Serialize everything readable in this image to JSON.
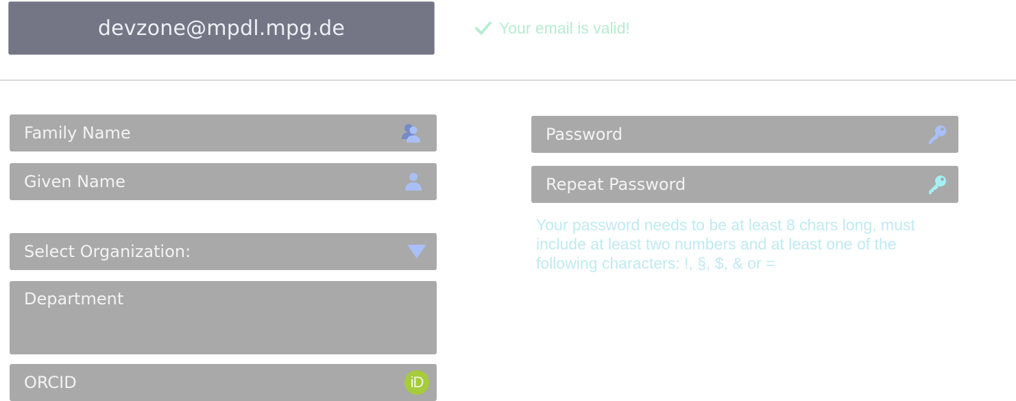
{
  "account": {
    "email": "devzone@mpdl.mpg.de",
    "email_status": "Your email is valid!"
  },
  "form": {
    "family_name_placeholder": "Family Name",
    "given_name_placeholder": "Given Name",
    "organization_placeholder": "Select Organization:",
    "department_placeholder": "Department",
    "orcid_placeholder": "ORCID",
    "orcid_icon_text": "iD",
    "password_placeholder": "Password",
    "repeat_password_placeholder": "Repeat Password",
    "password_hint": "Your password needs to be at least 8 chars long, must include at least two numbers and at least one of the following characters: !, §, $, & or ="
  },
  "icons": {
    "email_status": "check-icon",
    "family_name": "users-icon",
    "given_name": "user-icon",
    "organization": "triangle-down-icon",
    "orcid": "orcid-icon",
    "password": "key-icon",
    "repeat_password": "key-icon"
  },
  "colors": {
    "email_box": "#747686",
    "field_background": "#a9a9a9",
    "valid_text": "#b7ecd2",
    "icon_blue": "#a9bff7",
    "icon_cyan": "#a6f0f2",
    "orcid_green": "#a6cb3c",
    "hint_text": "#bfeaf1"
  }
}
